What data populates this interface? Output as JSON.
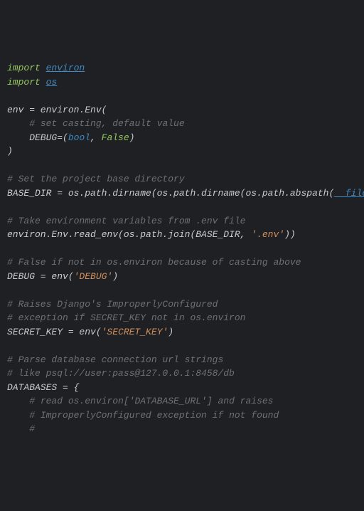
{
  "code": {
    "tokens": [
      {
        "t": "kw",
        "v": "import"
      },
      {
        "t": "plain",
        "v": " "
      },
      {
        "t": "mod",
        "v": "environ"
      },
      {
        "t": "nl"
      },
      {
        "t": "kw",
        "v": "import"
      },
      {
        "t": "plain",
        "v": " "
      },
      {
        "t": "mod",
        "v": "os"
      },
      {
        "t": "nl"
      },
      {
        "t": "nl"
      },
      {
        "t": "plain",
        "v": "env = environ.Env("
      },
      {
        "t": "nl"
      },
      {
        "t": "plain",
        "v": "    "
      },
      {
        "t": "comment",
        "v": "# set casting, default value"
      },
      {
        "t": "nl"
      },
      {
        "t": "plain",
        "v": "    DEBUG=("
      },
      {
        "t": "builtin",
        "v": "bool"
      },
      {
        "t": "plain",
        "v": ", "
      },
      {
        "t": "bool",
        "v": "False"
      },
      {
        "t": "plain",
        "v": ")"
      },
      {
        "t": "nl"
      },
      {
        "t": "plain",
        "v": ")"
      },
      {
        "t": "nl"
      },
      {
        "t": "nl"
      },
      {
        "t": "comment",
        "v": "# Set the project base directory"
      },
      {
        "t": "nl"
      },
      {
        "t": "plain",
        "v": "BASE_DIR = os.path.dirname(os.path.dirname(os.path.abspath("
      },
      {
        "t": "dunder",
        "v": "__file__"
      },
      {
        "t": "plain",
        "v": ")))"
      },
      {
        "t": "nl"
      },
      {
        "t": "nl"
      },
      {
        "t": "comment",
        "v": "# Take environment variables from .env file"
      },
      {
        "t": "nl"
      },
      {
        "t": "plain",
        "v": "environ.Env.read_env(os.path.join(BASE_DIR, "
      },
      {
        "t": "str",
        "v": "'.env'"
      },
      {
        "t": "plain",
        "v": "))"
      },
      {
        "t": "nl"
      },
      {
        "t": "nl"
      },
      {
        "t": "comment",
        "v": "# False if not in os.environ because of casting above"
      },
      {
        "t": "nl"
      },
      {
        "t": "plain",
        "v": "DEBUG = env("
      },
      {
        "t": "str",
        "v": "'DEBUG'"
      },
      {
        "t": "plain",
        "v": ")"
      },
      {
        "t": "nl"
      },
      {
        "t": "nl"
      },
      {
        "t": "comment",
        "v": "# Raises Django's ImproperlyConfigured"
      },
      {
        "t": "nl"
      },
      {
        "t": "comment",
        "v": "# exception if SECRET_KEY not in os.environ"
      },
      {
        "t": "nl"
      },
      {
        "t": "plain",
        "v": "SECRET_KEY = env("
      },
      {
        "t": "str",
        "v": "'SECRET_KEY'"
      },
      {
        "t": "plain",
        "v": ")"
      },
      {
        "t": "nl"
      },
      {
        "t": "nl"
      },
      {
        "t": "comment",
        "v": "# Parse database connection url strings"
      },
      {
        "t": "nl"
      },
      {
        "t": "comment",
        "v": "# like psql://user:pass@127.0.0.1:8458/db"
      },
      {
        "t": "nl"
      },
      {
        "t": "plain",
        "v": "DATABASES = {"
      },
      {
        "t": "nl"
      },
      {
        "t": "plain",
        "v": "    "
      },
      {
        "t": "comment",
        "v": "# read os.environ['DATABASE_URL'] and raises"
      },
      {
        "t": "nl"
      },
      {
        "t": "plain",
        "v": "    "
      },
      {
        "t": "comment",
        "v": "# ImproperlyConfigured exception if not found"
      },
      {
        "t": "nl"
      },
      {
        "t": "plain",
        "v": "    "
      },
      {
        "t": "comment",
        "v": "#"
      }
    ]
  }
}
